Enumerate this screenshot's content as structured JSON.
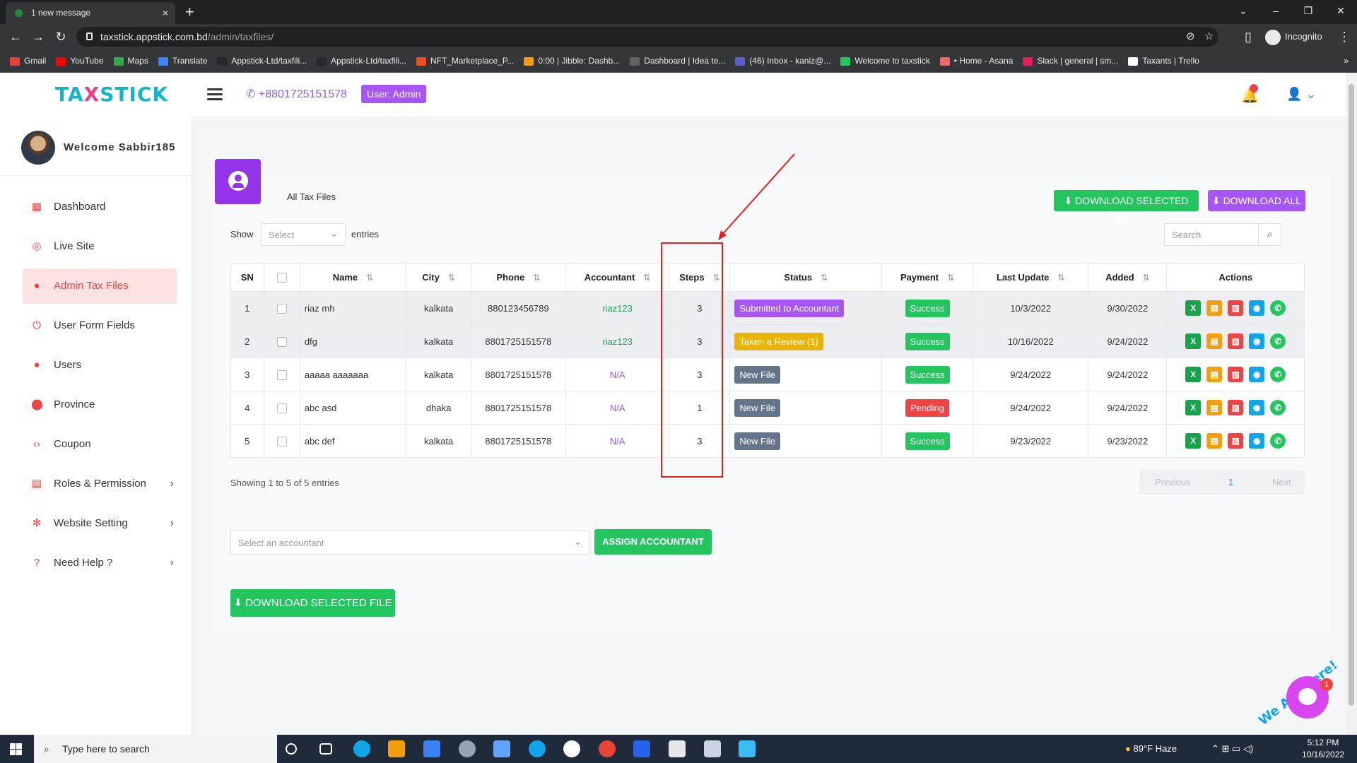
{
  "browser": {
    "tab_title": "1 new message",
    "tab_close": "×",
    "new_tab": "+",
    "url_host": "taxstick.appstick.com.bd",
    "url_path": "/admin/taxfiles/",
    "profile_label": "Incognito",
    "bookmarks": [
      {
        "label": "Gmail",
        "color": "#ea4335"
      },
      {
        "label": "YouTube",
        "color": "#ff0000"
      },
      {
        "label": "Maps",
        "color": "#34a853"
      },
      {
        "label": "Translate",
        "color": "#4285f4"
      },
      {
        "label": "Appstick-Ltd/taxfili...",
        "color": "#24292f"
      },
      {
        "label": "Appstick-Ltd/taxfili...",
        "color": "#24292f"
      },
      {
        "label": "NFT_Marketplace_P...",
        "color": "#f24e1e"
      },
      {
        "label": "0:00 | Jibble: Dashb...",
        "color": "#f59e0b"
      },
      {
        "label": "Dashboard | Idea te...",
        "color": "#5f6368"
      },
      {
        "label": "(46) Inbox - kaniz@...",
        "color": "#5b5fc7"
      },
      {
        "label": "Welcome to taxstick",
        "color": "#22c55e"
      },
      {
        "label": "• Home - Asana",
        "color": "#f06a6a"
      },
      {
        "label": "Slack | general | sm...",
        "color": "#e01e5a"
      },
      {
        "label": "Taxants | Trello",
        "color": "#ffffff"
      }
    ],
    "more": "»"
  },
  "header": {
    "logo_a": "TA",
    "logo_x": "X",
    "logo_b": "STICK",
    "phone": "+8801725151578",
    "role_badge": "User: Admin"
  },
  "sidebar": {
    "welcome": "Welcome Sabbir185",
    "items": [
      {
        "label": "Dashboard",
        "icon": "dashboard-icon"
      },
      {
        "label": "Live Site",
        "icon": "live-site-icon"
      },
      {
        "label": "Admin Tax Files",
        "icon": "user-circle-icon",
        "active": true
      },
      {
        "label": "User Form Fields",
        "icon": "power-icon"
      },
      {
        "label": "Users",
        "icon": "user-circle-icon"
      },
      {
        "label": "Province",
        "icon": "map-pin-icon"
      },
      {
        "label": "Coupon",
        "icon": "code-icon"
      },
      {
        "label": "Roles & Permission",
        "icon": "roles-icon",
        "has_submenu": true
      },
      {
        "label": "Website Setting",
        "icon": "gear-icon",
        "has_submenu": true
      },
      {
        "label": "Need Help ?",
        "icon": "help-icon",
        "has_submenu": true
      }
    ]
  },
  "page": {
    "title": "All Tax Files",
    "download_selected_top": "DOWNLOAD SELECTED FILE",
    "download_all": "DOWNLOAD ALL",
    "show_label": "Show",
    "show_select_placeholder": "Select",
    "entries_label": "entries",
    "search_placeholder": "Search",
    "showing_text": "Showing 1 to 5 of 5 entries",
    "pager": {
      "previous": "Previous",
      "current": "1",
      "next": "Next"
    },
    "assign_placeholder": "Select an accountant",
    "assign_button": "ASSIGN ACCOUNTANT",
    "download_selected_bottom": "DOWNLOAD SELECTED FILE"
  },
  "table": {
    "columns": [
      "SN",
      "",
      "Name",
      "City",
      "Phone",
      "Accountant",
      "Steps",
      "Status",
      "Payment",
      "Last Update",
      "Added",
      "Actions"
    ],
    "rows": [
      {
        "sn": "1",
        "name": "riaz mh",
        "city": "kalkata",
        "phone": "880123456789",
        "accountant": "riaz123",
        "steps": "3",
        "status": "Submitted to Accountant",
        "status_color": "#a855f7",
        "payment": "Success",
        "payment_color": "#22c55e",
        "last_update": "10/3/2022",
        "added": "9/30/2022"
      },
      {
        "sn": "2",
        "name": "dfg",
        "city": "kalkata",
        "phone": "8801725151578",
        "accountant": "riaz123",
        "steps": "3",
        "status": "Taken a Review (1)",
        "status_color": "#eab308",
        "payment": "Success",
        "payment_color": "#22c55e",
        "last_update": "10/16/2022",
        "added": "9/24/2022"
      },
      {
        "sn": "3",
        "name": "aaaaa aaaaaaa",
        "city": "kalkata",
        "phone": "8801725151578",
        "accountant": "N/A",
        "steps": "3",
        "status": "New File",
        "status_color": "#64748b",
        "payment": "Success",
        "payment_color": "#22c55e",
        "last_update": "9/24/2022",
        "added": "9/24/2022"
      },
      {
        "sn": "4",
        "name": "abc asd",
        "city": "dhaka",
        "phone": "8801725151578",
        "accountant": "N/A",
        "steps": "1",
        "status": "New File",
        "status_color": "#64748b",
        "payment": "Pending",
        "payment_color": "#ef4444",
        "last_update": "9/24/2022",
        "added": "9/24/2022"
      },
      {
        "sn": "5",
        "name": "abc def",
        "city": "kalkata",
        "phone": "8801725151578",
        "accountant": "N/A",
        "steps": "3",
        "status": "New File",
        "status_color": "#64748b",
        "payment": "Success",
        "payment_color": "#22c55e",
        "last_update": "9/23/2022",
        "added": "9/23/2022"
      }
    ]
  },
  "chat_widget": {
    "text": "We Are Here!",
    "count": "1"
  },
  "taskbar": {
    "search_placeholder": "Type here to search",
    "weather": "89°F  Haze",
    "time": "5:12 PM",
    "date": "10/16/2022"
  }
}
